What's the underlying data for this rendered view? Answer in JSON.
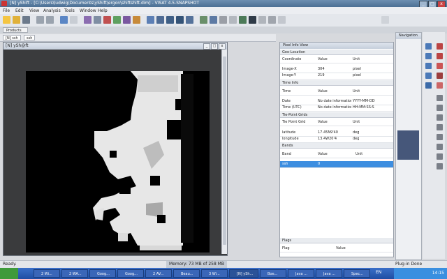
{
  "window": {
    "title": "[N] yShift - [C:\\Users\\ludwig\\Documents\\yShift\\ergon\\shiftshift.dim] - VISAT 4.5-SNAPSHOT",
    "min": "_",
    "max": "□",
    "close": "x"
  },
  "menu": [
    "File",
    "Edit",
    "View",
    "Analysis",
    "Tools",
    "Window",
    "Help"
  ],
  "tabs": {
    "product": "Products",
    "views": [
      "[N] ssh",
      "ssh"
    ]
  },
  "image_window": {
    "title": "[N] ySh@ft"
  },
  "info_panel": {
    "title": "Pixel Info View",
    "sections": {
      "position": {
        "title": "Geo-Location",
        "header": [
          "Coordinate",
          "Value",
          "Unit"
        ],
        "rows": [
          [
            "Image-X",
            "304",
            "pixel"
          ],
          [
            "Image-Y",
            "219",
            "pixel"
          ]
        ]
      },
      "time": {
        "title": "Time Info",
        "header": [
          "Time",
          "Value",
          "Unit"
        ],
        "rows": [
          [
            "Date",
            "No date information",
            "YYYY-MM-DD"
          ],
          [
            "Time (UTC)",
            "No date information",
            "HH:MM:SS:S"
          ]
        ]
      },
      "geo": {
        "title": "Tie-Point Grids",
        "header": [
          "Tie Point Grid",
          "Value",
          "Unit"
        ],
        "rows": [
          [
            "latitude",
            "17.45N9'40",
            "deg"
          ],
          [
            "longitude",
            "13.4W20'4",
            "deg"
          ]
        ]
      },
      "bands": {
        "title": "Bands",
        "header": [
          "Band",
          "Value",
          "Unit"
        ],
        "rows": [
          [
            "ssh",
            "0",
            ""
          ]
        ]
      },
      "flags": {
        "title": "Flags",
        "header": [
          "Flag",
          "Value"
        ]
      }
    }
  },
  "navigation": {
    "title": "Navigation"
  },
  "status": {
    "left": "Ready.",
    "mem": "Memory: 73 MB of 258 MB",
    "right": "Plug-in Done"
  },
  "taskbar": {
    "items": [
      "2 Wi...",
      "2 WA...",
      "Goog...",
      "Goog...",
      "2 AV...",
      "Beau...",
      "3 Wi...",
      "[N] ySh...",
      "Boe...",
      "Java ...",
      "Java ...",
      "Spec..."
    ],
    "clock": "14:15",
    "lang": "EN"
  }
}
